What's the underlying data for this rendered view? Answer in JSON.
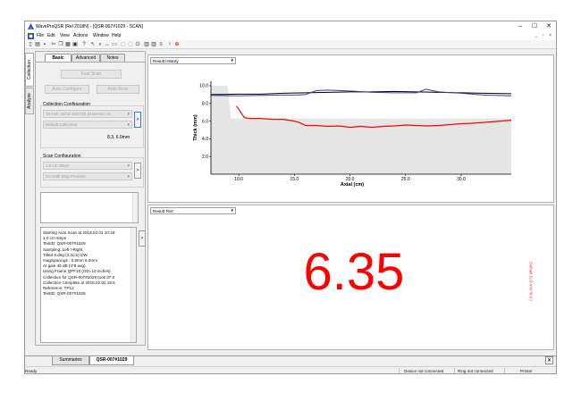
{
  "window": {
    "title": "WaveProQSR (Rel 2018N) - [QSR-007#1029 - SCAN]",
    "controls": {
      "minimize": "–",
      "maximize": "☐",
      "close": "✕"
    },
    "mdi_controls": "_ ▫ ×"
  },
  "menu": [
    "File",
    "Edit",
    "View",
    "Actions",
    "Window",
    "Help"
  ],
  "sidebar_tabs": [
    "Collection",
    "Analyze"
  ],
  "panel": {
    "tabs": [
      "Basic",
      "Advanced",
      "Notes"
    ],
    "fast_scan": "Fast Scan",
    "auto_configure": "Auto Configure",
    "auto_scan": "Auto Scan",
    "collection_config": {
      "label": "Collection Configuration",
      "pipe": "10 inch, Schd 30(STD) (9.53 mm / 0.:",
      "collection": "Default Collection",
      "value": "8.3, 6.0mm",
      "more_button": ">"
    },
    "scan_config": {
      "label": "Scan Configuration",
      "steps": "1.0 cm Steps",
      "mode": "Go Until Stop Pressed",
      "more_button": ">"
    },
    "log_lines": [
      "Starting Auto Scan at 2018.02.01 10:19:",
      "1.0 cm steps",
      "TestID: QSR-007#1029",
      "Sampling: Left->Right",
      "Tilted 9 deg (3.2cm) CW",
      "magSpacings : 0.5mm 6.0mm",
      "At gain 48 dB (4*8 avg)",
      "Using Frame QPF10 (OD=10 inches)",
      "Collection for QSR-007#1029 took 37.0",
      "Collection Complete at 2018.02.01 15:5",
      "Reference: TP12",
      "TestID: QSR-007#1029"
    ],
    "log_more_button": ">"
  },
  "graph_pane": {
    "selector": "Result History"
  },
  "text_pane": {
    "selector": "Result Text",
    "big_value": "6.35",
    "side_value": "Default (2.0 mm /0.0 )"
  },
  "bottom_tabs": [
    "Summaries",
    "QSR-007#1029"
  ],
  "bottom_close": "✕",
  "status": {
    "left": "Ready",
    "device": "Device not connected",
    "ring": "Ring not connected",
    "printer": "Printer"
  },
  "colors": {
    "red_line": "#ff0000",
    "blue_line": "#3a3aa8",
    "black_line": "#000000",
    "fill": "#e6e6e6"
  },
  "chart_data": {
    "type": "line",
    "xlabel": "Axial (cm)",
    "ylabel": "Thick (mm)",
    "xlim": [
      7.5,
      34.5
    ],
    "ylim": [
      0,
      10.5
    ],
    "x_ticks": [
      10.0,
      15.0,
      20.0,
      25.0,
      30.0
    ],
    "y_ticks": [
      2.0,
      4.0,
      6.0,
      8.0,
      10.0
    ],
    "grid": false,
    "series": [
      {
        "role": "area",
        "color": "#e6e6e6",
        "x": [
          7.5,
          9.0,
          9.3,
          10.0,
          34.5
        ],
        "y": [
          10.0,
          10.0,
          6.3,
          6.3,
          6.3
        ]
      },
      {
        "role": "black",
        "color": "#000000",
        "x": [
          7.5,
          10,
          12,
          14,
          16,
          18,
          20,
          22,
          24,
          26,
          28,
          30,
          32,
          34.5
        ],
        "y": [
          9.0,
          9.05,
          9.05,
          9.15,
          9.2,
          9.25,
          9.3,
          9.3,
          9.35,
          9.3,
          9.25,
          9.2,
          9.15,
          9.1
        ]
      },
      {
        "role": "blue",
        "color": "#3a3aa8",
        "x": [
          7.5,
          10,
          12,
          14,
          15,
          16,
          17,
          18,
          20,
          22,
          24,
          26,
          26.8,
          28,
          30,
          32,
          34.5
        ],
        "y": [
          8.9,
          8.85,
          8.9,
          8.95,
          8.95,
          9.0,
          9.45,
          9.5,
          9.4,
          9.25,
          9.2,
          9.2,
          9.6,
          9.3,
          9.15,
          8.95,
          8.85
        ]
      },
      {
        "role": "red",
        "color": "#ff0000",
        "x": [
          9.8,
          10.5,
          11,
          12,
          13,
          14,
          15,
          15.5,
          16,
          17,
          18,
          19,
          20,
          21,
          22,
          23,
          24,
          25,
          26,
          27,
          28,
          29,
          30,
          31,
          32,
          33,
          34.5
        ],
        "y": [
          7.7,
          6.4,
          6.3,
          6.3,
          6.2,
          6.2,
          6.0,
          5.8,
          5.5,
          5.5,
          5.4,
          5.45,
          5.3,
          5.4,
          5.3,
          5.4,
          5.45,
          5.55,
          5.5,
          5.45,
          5.5,
          5.6,
          5.7,
          5.75,
          5.85,
          5.95,
          6.1
        ]
      }
    ]
  }
}
